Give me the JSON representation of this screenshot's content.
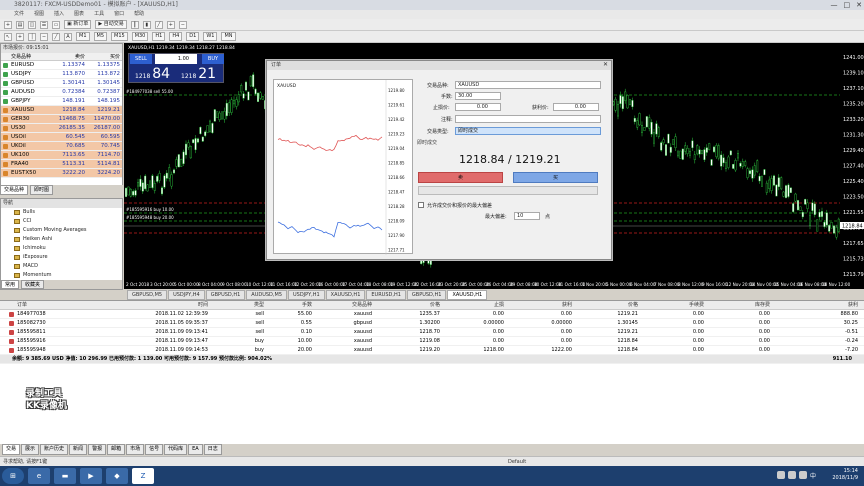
{
  "window": {
    "title": "3820117: FXCM-USDDemo01 - 模拟账户 - [XAUUSD,H1]",
    "controls": [
      "—",
      "□",
      "✕"
    ]
  },
  "menu": [
    "文件",
    "视图",
    "插入",
    "图表",
    "工具",
    "窗口",
    "帮助"
  ],
  "toolbar": {
    "new_order": "新订单",
    "autotrade": "自动交易",
    "timeframes": [
      "M1",
      "M5",
      "M15",
      "M30",
      "H1",
      "H4",
      "D1",
      "W1",
      "MN"
    ]
  },
  "market_watch": {
    "header": "市场报价: 09:15:01",
    "col_symbol": "交易品种",
    "col_bid": "卖价",
    "col_ask": "买价",
    "rows": [
      {
        "symbol": "EURUSD",
        "bid": "1.13374",
        "ask": "1.13375",
        "color": "#3fa34d",
        "hl": false
      },
      {
        "symbol": "USDJPY",
        "bid": "113.870",
        "ask": "113.872",
        "color": "#3fa34d",
        "hl": false
      },
      {
        "symbol": "GBPUSD",
        "bid": "1.30141",
        "ask": "1.30145",
        "color": "#3fa34d",
        "hl": false
      },
      {
        "symbol": "AUDUSD",
        "bid": "0.72384",
        "ask": "0.72387",
        "color": "#3fa34d",
        "hl": false
      },
      {
        "symbol": "GBPJPY",
        "bid": "148.191",
        "ask": "148.195",
        "color": "#3fa34d",
        "hl": false
      },
      {
        "symbol": "XAUUSD",
        "bid": "1218.84",
        "ask": "1219.21",
        "color": "#d9852b",
        "hl": true
      },
      {
        "symbol": "GER30",
        "bid": "11468.75",
        "ask": "11470.00",
        "color": "#d9852b",
        "hl": true
      },
      {
        "symbol": "US30",
        "bid": "26185.35",
        "ask": "26187.00",
        "color": "#d9852b",
        "hl": true
      },
      {
        "symbol": "USOil",
        "bid": "60.545",
        "ask": "60.595",
        "color": "#d9852b",
        "hl": true
      },
      {
        "symbol": "UKOil",
        "bid": "70.685",
        "ask": "70.745",
        "color": "#d9852b",
        "hl": true
      },
      {
        "symbol": "UK100",
        "bid": "7113.65",
        "ask": "7114.70",
        "color": "#d9852b",
        "hl": true
      },
      {
        "symbol": "FRA40",
        "bid": "5113.31",
        "ask": "5114.81",
        "color": "#d9852b",
        "hl": true
      },
      {
        "symbol": "EUSTX50",
        "bid": "3222.20",
        "ask": "3224.20",
        "color": "#d9852b",
        "hl": true
      }
    ],
    "tabs": [
      "交易品种",
      "即时图"
    ]
  },
  "navigator": {
    "title": "导航",
    "items": [
      "Bulls",
      "CCI",
      "Custom Moving Averages",
      "Heiken Ashi",
      "Ichimoku",
      "iExposure",
      "MACD",
      "Momentum",
      "OsMA"
    ],
    "tabs": [
      "常用",
      "收藏夹"
    ]
  },
  "chart": {
    "symbol_label": "XAUUSD,H1 1219.34 1219.34 1218.27 1218.84",
    "price_ticks": [
      "1241.00",
      "1239.10",
      "1237.10",
      "1235.20",
      "1233.20",
      "1231.30",
      "1229.40",
      "1227.40",
      "1225.40",
      "1223.50",
      "1221.55",
      "1218.84",
      "1217.65",
      "1215.73",
      "1213.79"
    ],
    "current_price": "1218.84",
    "time_ticks": [
      "2 Oct 2018",
      "3 Oct 20:00",
      "5 Oct 00:00",
      "8 Oct 04:00",
      "9 Oct 08:00",
      "10 Oct 12:00",
      "11 Oct 16:00",
      "12 Oct 20:00",
      "16 Oct 00:00",
      "17 Oct 04:00",
      "18 Oct 08:00",
      "19 Oct 12:00",
      "22 Oct 16:00",
      "23 Oct 20:00",
      "25 Oct 00:00",
      "26 Oct 04:00",
      "29 Oct 08:00",
      "30 Oct 12:00",
      "31 Oct 16:00",
      "1 Nov 20:00",
      "5 Nov 00:00",
      "6 Nov 04:00",
      "7 Nov 08:00",
      "8 Nov 12:00",
      "9 Nov 16:00",
      "12 Nov 20:00",
      "14 Nov 00:00",
      "15 Nov 04:00",
      "16 Nov 08:00",
      "18 Nov 12:00"
    ],
    "trade_line_labels": [
      "#184977038 sell 55.00",
      "#185595916 buy 10.00",
      "#185595948 buy 20.00"
    ],
    "tabs": [
      "GBPUSD,M5",
      "USDJPY,H4",
      "GBPUSD,H1",
      "AUDUSD,M5",
      "USDJPY,H1",
      "XAUUSD,H1",
      "EURUSD,H1",
      "GBPUSD,H1",
      "XAUUSD,H1"
    ],
    "active_tab": 8
  },
  "one_click": {
    "sell": "SELL",
    "buy": "BUY",
    "qty": "1.00",
    "sell_big": "84",
    "sell_small": "1218",
    "buy_big": "21",
    "buy_small": "1218"
  },
  "order_dialog": {
    "title": "订单",
    "close": "✕",
    "mini_symbol": "XAUUSD",
    "mini_ticks": [
      "1219.80",
      "1219.61",
      "1219.42",
      "1219.23",
      "1219.04",
      "1218.85",
      "1218.66",
      "1218.47",
      "1218.28",
      "1218.09",
      "1217.90",
      "1217.71"
    ],
    "symbol_label": "交易品种:",
    "symbol_value": "XAUUSD",
    "volume_label": "手数:",
    "volume_value": "30.00",
    "sl_label": "止损价:",
    "sl_value": "0.00",
    "tp_label": "获利价:",
    "tp_value": "0.00",
    "comment_label": "注释:",
    "comment_value": "",
    "type_label": "交易类型:",
    "type_value": "即时成交",
    "section_label": "即时成交",
    "prices": "1218.84 / 1219.21",
    "sell_button": "卖",
    "buy_button": "买",
    "deviation_check": "允许成交价和报价的最大偏差",
    "max_dev_label": "最大偏差:",
    "max_dev_value": "10",
    "max_dev_unit": "点"
  },
  "terminal": {
    "headers": [
      "订单",
      "时间",
      "类型",
      "手数",
      "交易品种",
      "价格",
      "止损",
      "获利",
      "价格",
      "手续费",
      "库存费",
      "获利"
    ],
    "rows": [
      [
        "184977038",
        "2018.11.02 12:39:39",
        "sell",
        "55.00",
        "xauusd",
        "1235.37",
        "0.00",
        "0.00",
        "1219.21",
        "0.00",
        "0.00",
        "888.80"
      ],
      [
        "185082730",
        "2018.11.05 09:35:37",
        "sell",
        "0.55",
        "gbpusd",
        "1.30200",
        "0.00000",
        "0.00000",
        "1.30145",
        "0.00",
        "0.00",
        "30.25"
      ],
      [
        "185595811",
        "2018.11.09 09:13:41",
        "sell",
        "0.10",
        "xauusd",
        "1218.70",
        "0.00",
        "0.00",
        "1219.21",
        "0.00",
        "0.00",
        "-0.51"
      ],
      [
        "185595916",
        "2018.11.09 09:13:47",
        "buy",
        "10.00",
        "xauusd",
        "1219.08",
        "0.00",
        "0.00",
        "1218.84",
        "0.00",
        "0.00",
        "-0.24"
      ],
      [
        "185595948",
        "2018.11.09 09:14:53",
        "buy",
        "20.00",
        "xauusd",
        "1219.20",
        "1218.00",
        "1222.00",
        "1218.84",
        "0.00",
        "0.00",
        "-7.20"
      ]
    ],
    "total_label": "余额: 9 385.69 USD 净值: 10 296.99 已用预付款: 1 139.00 可用预付款: 9 157.99 预付款比例: 904.02%",
    "total_value": "911.10",
    "tabs": [
      "交易",
      "展示",
      "账户历史",
      "新闻",
      "警报",
      "邮箱",
      "市场",
      "信号",
      "代码库",
      "EA",
      "日志"
    ]
  },
  "watermark": {
    "line1": "录制工具",
    "line2": "KK录像机"
  },
  "status": {
    "left": "寻求帮助, 请按F1键",
    "profile": "Default"
  },
  "taskbar": {
    "time": "15:14",
    "date": "2018/11/9",
    "lang": "中"
  }
}
